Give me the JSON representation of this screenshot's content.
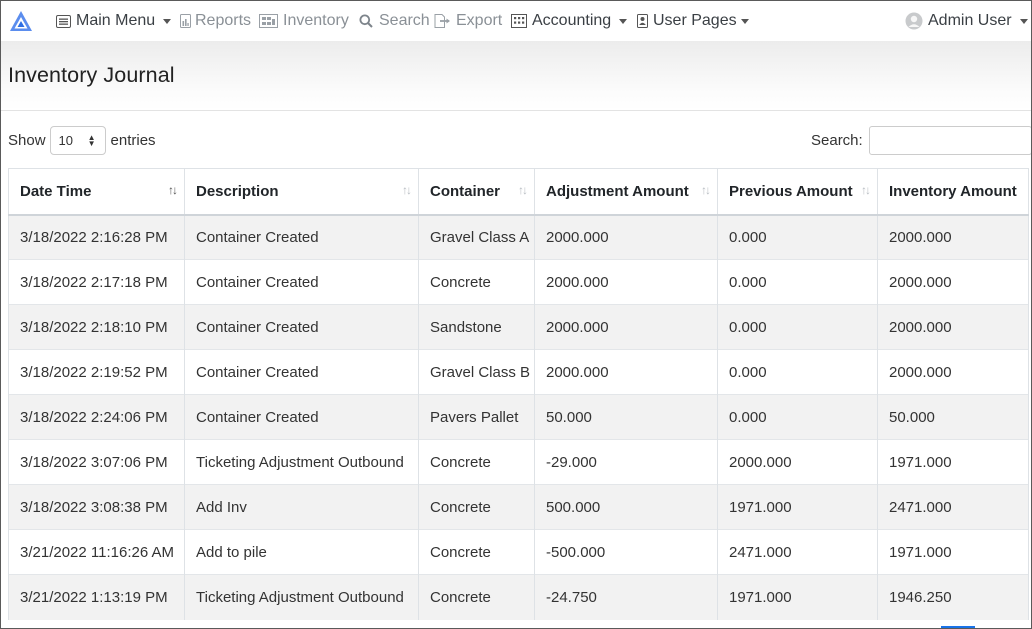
{
  "nav": {
    "main_menu": "Main Menu",
    "reports": "Reports",
    "inventory": "Inventory",
    "search": "Search",
    "export": "Export",
    "accounting": "Accounting",
    "user_pages": "User Pages",
    "admin_user": "Admin User"
  },
  "page": {
    "title": "Inventory Journal"
  },
  "controls": {
    "show_label": "Show",
    "entries_value": "10",
    "entries_label": "entries",
    "search_label": "Search:",
    "search_value": ""
  },
  "table": {
    "headers": [
      "Date Time",
      "Description",
      "Container",
      "Adjustment Amount",
      "Previous Amount",
      "Inventory Amount"
    ],
    "rows": [
      [
        "3/18/2022 2:16:28 PM",
        "Container Created",
        "Gravel Class A",
        "2000.000",
        "0.000",
        "2000.000"
      ],
      [
        "3/18/2022 2:17:18 PM",
        "Container Created",
        "Concrete",
        "2000.000",
        "0.000",
        "2000.000"
      ],
      [
        "3/18/2022 2:18:10 PM",
        "Container Created",
        "Sandstone",
        "2000.000",
        "0.000",
        "2000.000"
      ],
      [
        "3/18/2022 2:19:52 PM",
        "Container Created",
        "Gravel Class B",
        "2000.000",
        "0.000",
        "2000.000"
      ],
      [
        "3/18/2022 2:24:06 PM",
        "Container Created",
        "Pavers Pallet",
        "50.000",
        "0.000",
        "50.000"
      ],
      [
        "3/18/2022 3:07:06 PM",
        "Ticketing Adjustment Outbound",
        "Concrete",
        "-29.000",
        "2000.000",
        "1971.000"
      ],
      [
        "3/18/2022 3:08:38 PM",
        "Add Inv",
        "Concrete",
        "500.000",
        "1971.000",
        "2471.000"
      ],
      [
        "3/21/2022 11:16:26 AM",
        "Add to pile",
        "Concrete",
        "-500.000",
        "2471.000",
        "1971.000"
      ],
      [
        "3/21/2022 1:13:19 PM",
        "Ticketing Adjustment Outbound",
        "Concrete",
        "-24.750",
        "1971.000",
        "1946.250"
      ]
    ]
  },
  "colors": {
    "brand": "#2f6fe4",
    "stripe": "#f2f2f2",
    "muted_nav": "#8a9096"
  },
  "icons": {
    "brand": "triangle-logo-icon",
    "main_menu": "list-icon",
    "reports": "report-icon",
    "inventory": "warehouse-icon",
    "search": "search-icon",
    "export": "export-icon",
    "accounting": "calculator-icon",
    "user_pages": "user-file-icon",
    "admin_user": "user-avatar-icon"
  }
}
